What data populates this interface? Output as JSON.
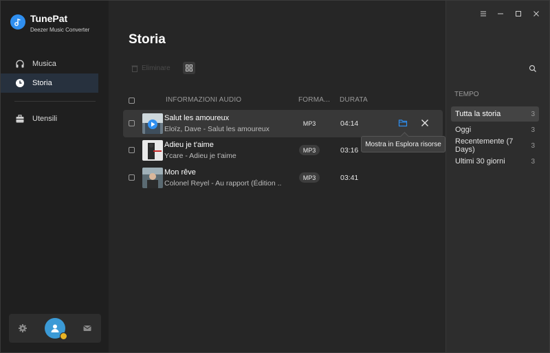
{
  "app": {
    "name": "TunePat",
    "subtitle": "Deezer Music Converter"
  },
  "sidebar": {
    "items": [
      {
        "label": "Musica",
        "icon": "headphones-icon"
      },
      {
        "label": "Storia",
        "icon": "clock-icon",
        "active": true
      },
      {
        "label": "Utensili",
        "icon": "toolbox-icon"
      }
    ],
    "bottom": {
      "settings_icon": "gear-icon",
      "avatar_icon": "user-avatar-icon",
      "mail_icon": "mail-icon"
    }
  },
  "main": {
    "title": "Storia",
    "toolbar": {
      "delete_label": "Eliminare"
    },
    "columns": {
      "info": "INFORMAZIONI AUDIO",
      "format": "FORMA...",
      "duration": "DURATA"
    },
    "rows": [
      {
        "title": "Salut les amoureux",
        "subtitle": "Eloïz, Dave - Salut les amoureux",
        "format": "MP3",
        "duration": "04:14"
      },
      {
        "title": "Adieu je t'aime",
        "subtitle": "Ycare - Adieu je t'aime",
        "format": "MP3",
        "duration": "03:16"
      },
      {
        "title": "Mon rêve",
        "subtitle": "Colonel Reyel - Au rapport (Édition ...",
        "format": "MP3",
        "duration": "03:41"
      }
    ],
    "tooltip": "Mostra in Esplora risorse"
  },
  "right_panel": {
    "header": "TEMPO",
    "filters": [
      {
        "label": "Tutta la storia",
        "count": "3",
        "active": true
      },
      {
        "label": "Oggi",
        "count": "3"
      },
      {
        "label": "Recentemente (7 Days)",
        "count": "3"
      },
      {
        "label": "Ultimi 30 giorni",
        "count": "3"
      }
    ]
  },
  "colors": {
    "accent": "#2f8ff0",
    "sidebar_bg": "#1f1f1f",
    "main_bg": "#262626"
  }
}
